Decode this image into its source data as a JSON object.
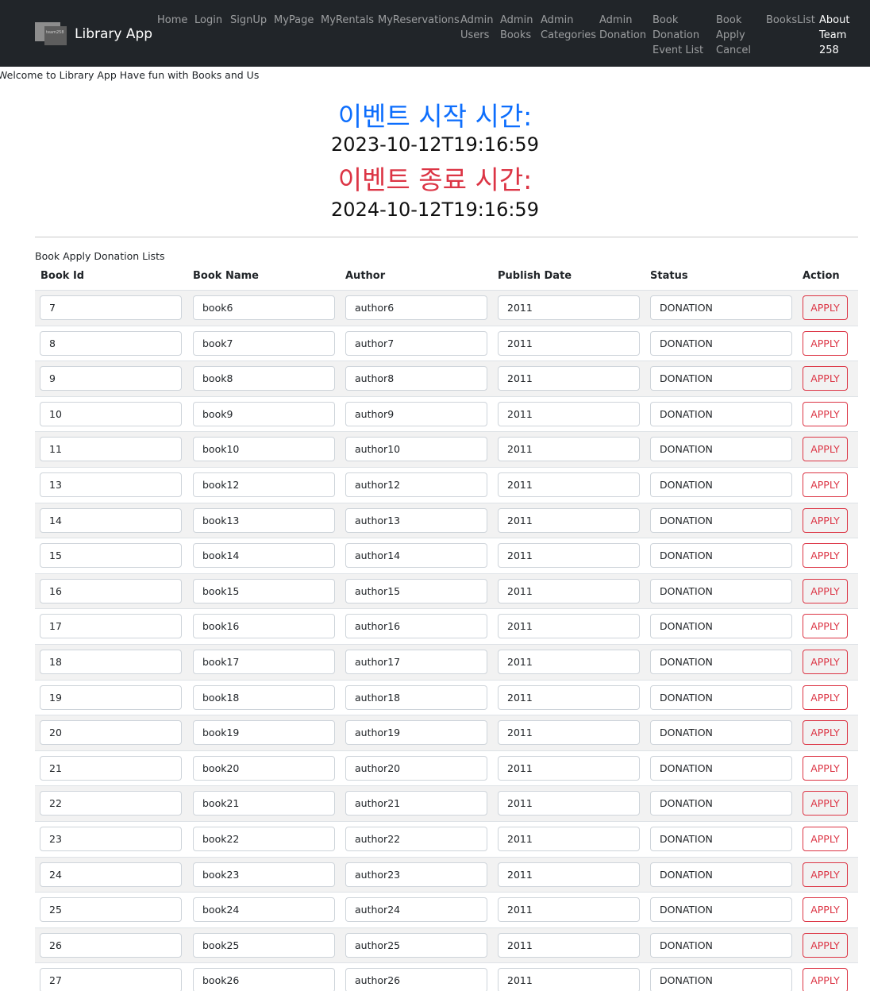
{
  "brand": {
    "name": "Library App",
    "logo_text": "team258"
  },
  "nav": [
    {
      "label": "Home",
      "active": true
    },
    {
      "label": "Login"
    },
    {
      "label": "SignUp"
    },
    {
      "label": "MyPage"
    },
    {
      "label": "MyRentals"
    },
    {
      "label": "MyReservations"
    },
    {
      "label": "Admin\nUsers"
    },
    {
      "label": "Admin\nBooks"
    },
    {
      "label": "Admin\nCategories"
    },
    {
      "label": "Admin\nDonation"
    },
    {
      "label": "Book\nDonation\nEvent List"
    },
    {
      "label": "Book\nApply\nCancel"
    },
    {
      "label": "BooksList"
    },
    {
      "label": "About\nTeam\n258",
      "active": true
    }
  ],
  "welcome": "Welcome to Library App Have fun with Books and Us",
  "event": {
    "start_label": "이벤트 시작 시간:",
    "start_time": "2023-10-12T19:16:59",
    "end_label": "이벤트 종료 시간:",
    "end_time": "2024-10-12T19:16:59"
  },
  "table": {
    "caption": "Book Apply Donation Lists",
    "headers": [
      "Book Id",
      "Book Name",
      "Author",
      "Publish Date",
      "Status",
      "Action"
    ],
    "action_label": "APPLY",
    "rows": [
      {
        "id": "7",
        "name": "book6",
        "author": "author6",
        "date": "2011",
        "status": "DONATION"
      },
      {
        "id": "8",
        "name": "book7",
        "author": "author7",
        "date": "2011",
        "status": "DONATION"
      },
      {
        "id": "9",
        "name": "book8",
        "author": "author8",
        "date": "2011",
        "status": "DONATION"
      },
      {
        "id": "10",
        "name": "book9",
        "author": "author9",
        "date": "2011",
        "status": "DONATION"
      },
      {
        "id": "11",
        "name": "book10",
        "author": "author10",
        "date": "2011",
        "status": "DONATION"
      },
      {
        "id": "13",
        "name": "book12",
        "author": "author12",
        "date": "2011",
        "status": "DONATION"
      },
      {
        "id": "14",
        "name": "book13",
        "author": "author13",
        "date": "2011",
        "status": "DONATION"
      },
      {
        "id": "15",
        "name": "book14",
        "author": "author14",
        "date": "2011",
        "status": "DONATION"
      },
      {
        "id": "16",
        "name": "book15",
        "author": "author15",
        "date": "2011",
        "status": "DONATION"
      },
      {
        "id": "17",
        "name": "book16",
        "author": "author16",
        "date": "2011",
        "status": "DONATION"
      },
      {
        "id": "18",
        "name": "book17",
        "author": "author17",
        "date": "2011",
        "status": "DONATION"
      },
      {
        "id": "19",
        "name": "book18",
        "author": "author18",
        "date": "2011",
        "status": "DONATION"
      },
      {
        "id": "20",
        "name": "book19",
        "author": "author19",
        "date": "2011",
        "status": "DONATION"
      },
      {
        "id": "21",
        "name": "book20",
        "author": "author20",
        "date": "2011",
        "status": "DONATION"
      },
      {
        "id": "22",
        "name": "book21",
        "author": "author21",
        "date": "2011",
        "status": "DONATION"
      },
      {
        "id": "23",
        "name": "book22",
        "author": "author22",
        "date": "2011",
        "status": "DONATION"
      },
      {
        "id": "24",
        "name": "book23",
        "author": "author23",
        "date": "2011",
        "status": "DONATION"
      },
      {
        "id": "25",
        "name": "book24",
        "author": "author24",
        "date": "2011",
        "status": "DONATION"
      },
      {
        "id": "26",
        "name": "book25",
        "author": "author25",
        "date": "2011",
        "status": "DONATION"
      },
      {
        "id": "27",
        "name": "book26",
        "author": "author26",
        "date": "2011",
        "status": "DONATION"
      }
    ]
  },
  "colors": {
    "navbar": "#212529",
    "start": "#0d6efd",
    "end": "#dc3545",
    "apply": "#dc3545"
  }
}
